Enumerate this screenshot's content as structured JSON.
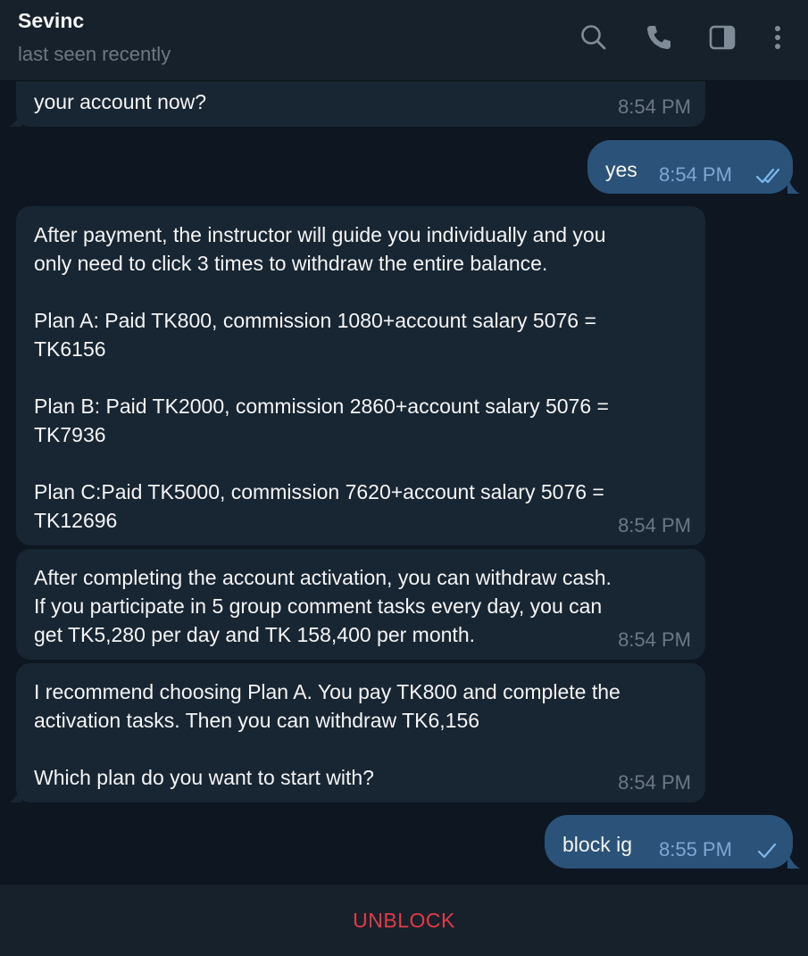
{
  "header": {
    "contact_name": "Sevinc",
    "status": "last seen recently",
    "icons": [
      "search-icon",
      "phone-icon",
      "sidebar-toggle-icon",
      "more-vertical-icon"
    ]
  },
  "messages": [
    {
      "direction": "in",
      "text": "your account now?",
      "time": "8:54 PM"
    },
    {
      "direction": "out",
      "text": "yes",
      "time": "8:54 PM",
      "status": "read"
    },
    {
      "direction": "in",
      "text": "After payment, the instructor will guide you individually and you\nonly need to click 3 times to withdraw the entire balance.\n\nPlan A: Paid TK800, commission 1080+account salary 5076 =\nTK6156\n\nPlan B: Paid TK2000, commission 2860+account salary 5076 =\nTK7936\n\nPlan C:Paid TK5000, commission 7620+account salary 5076 =\nTK12696",
      "time": "8:54 PM"
    },
    {
      "direction": "in",
      "text": "After completing the account activation, you can withdraw cash.\nIf you participate in 5 group comment tasks every day, you can\nget TK5,280 per day and TK 158,400 per month.",
      "time": "8:54 PM"
    },
    {
      "direction": "in",
      "text": "I recommend choosing Plan A. You pay TK800 and complete the\nactivation tasks. Then you can withdraw TK6,156\n\nWhich plan do you want to start with?",
      "time": "8:54 PM"
    },
    {
      "direction": "out",
      "text": "block ig",
      "time": "8:55 PM",
      "status": "sent"
    }
  ],
  "footer": {
    "action_label": "UNBLOCK"
  },
  "colors": {
    "background": "#0e1621",
    "header": "#17212b",
    "incoming_bubble": "#182533",
    "outgoing_bubble": "#2b5278",
    "unblock": "#e53945"
  }
}
